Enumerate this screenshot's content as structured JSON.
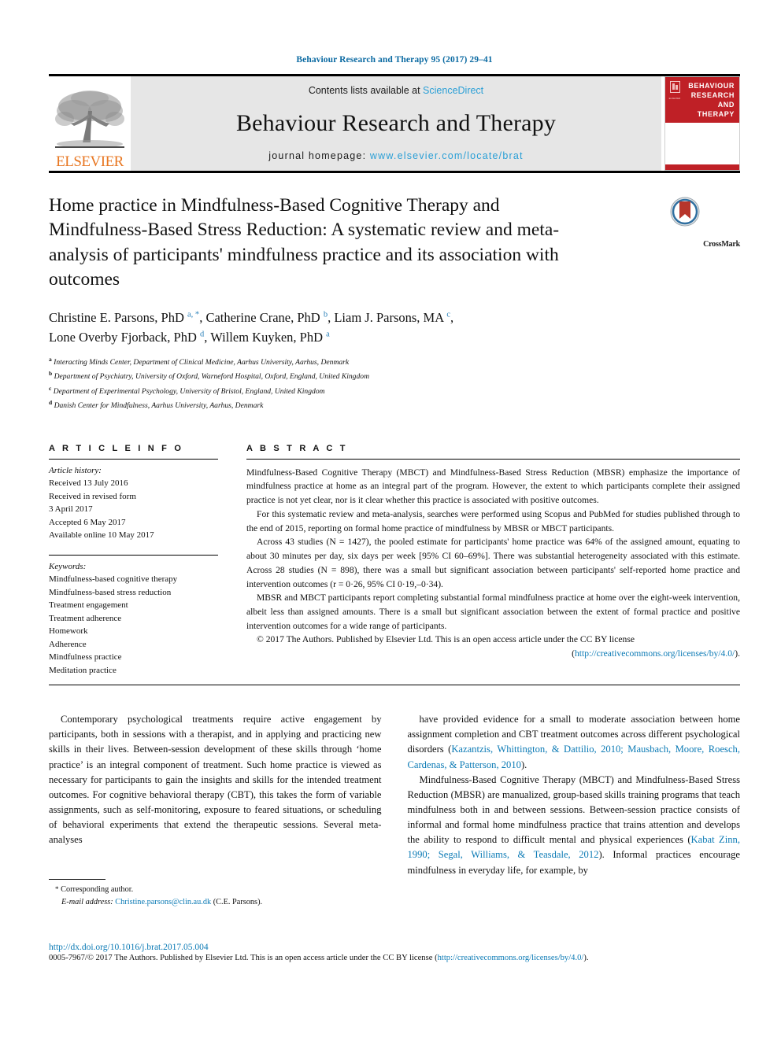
{
  "running_head": "Behaviour Research and Therapy 95 (2017) 29–41",
  "masthead": {
    "publisher_logo_label": "ELSEVIER",
    "contents_prefix": "Contents lists available at ",
    "contents_link": "ScienceDirect",
    "journal_title": "Behaviour Research and Therapy",
    "homepage_prefix": "journal homepage: ",
    "homepage_link": "www.elsevier.com/locate/brat",
    "cover_title_lines": [
      "BEHAVIOUR",
      "RESEARCH AND",
      "THERAPY"
    ],
    "cover_mark_text": "ELSEVIER"
  },
  "crossmark": {
    "label": "CrossMark"
  },
  "article": {
    "title": "Home practice in Mindfulness-Based Cognitive Therapy and Mindfulness-Based Stress Reduction: A systematic review and meta-analysis of participants' mindfulness practice and its association with outcomes",
    "authors_line_1_parts": [
      {
        "text": "Christine E. Parsons, PhD "
      },
      {
        "sup": "a, *"
      },
      {
        "text": ", Catherine Crane, PhD "
      },
      {
        "sup": "b"
      },
      {
        "text": ", Liam J. Parsons, MA "
      },
      {
        "sup": "c"
      },
      {
        "text": ","
      }
    ],
    "authors_line_2_parts": [
      {
        "text": "Lone Overby Fjorback, PhD "
      },
      {
        "sup": "d"
      },
      {
        "text": ", Willem Kuyken, PhD "
      },
      {
        "sup": "a"
      }
    ],
    "affiliations": [
      {
        "marker": "a",
        "text": "Interacting Minds Center, Department of Clinical Medicine, Aarhus University, Aarhus, Denmark"
      },
      {
        "marker": "b",
        "text": "Department of Psychiatry, University of Oxford, Warneford Hospital, Oxford, England, United Kingdom"
      },
      {
        "marker": "c",
        "text": "Department of Experimental Psychology, University of Bristol, England, United Kingdom"
      },
      {
        "marker": "d",
        "text": "Danish Center for Mindfulness, Aarhus University, Aarhus, Denmark"
      }
    ]
  },
  "article_info": {
    "heading": "A R T I C L E   I N F O",
    "history_label": "Article history:",
    "history": [
      "Received 13 July 2016",
      "Received in revised form",
      "3 April 2017",
      "Accepted 6 May 2017",
      "Available online 10 May 2017"
    ],
    "keywords_label": "Keywords:",
    "keywords": [
      "Mindfulness-based cognitive therapy",
      "Mindfulness-based stress reduction",
      "Treatment engagement",
      "Treatment adherence",
      "Homework",
      "Adherence",
      "Mindfulness practice",
      "Meditation practice"
    ]
  },
  "abstract": {
    "heading": "A B S T R A C T",
    "paragraphs": [
      "Mindfulness-Based Cognitive Therapy (MBCT) and Mindfulness-Based Stress Reduction (MBSR) emphasize the importance of mindfulness practice at home as an integral part of the program. However, the extent to which participants complete their assigned practice is not yet clear, nor is it clear whether this practice is associated with positive outcomes.",
      "For this systematic review and meta-analysis, searches were performed using Scopus and PubMed for studies published through to the end of 2015, reporting on formal home practice of mindfulness by MBSR or MBCT participants.",
      "Across 43 studies (N = 1427), the pooled estimate for participants' home practice was 64% of the assigned amount, equating to about 30 minutes per day, six days per week [95% CI 60–69%]. There was substantial heterogeneity associated with this estimate. Across 28 studies (N = 898), there was a small but significant association between participants' self-reported home practice and intervention outcomes (r = 0·26, 95% CI 0·19,–0·34).",
      "MBSR and MBCT participants report completing substantial formal mindfulness practice at home over the eight-week intervention, albeit less than assigned amounts. There is a small but significant association between the extent of formal practice and positive intervention outcomes for a wide range of participants."
    ],
    "copyright_text": "© 2017 The Authors. Published by Elsevier Ltd. This is an open access article under the CC BY license",
    "license_open_paren": "(",
    "license_link": "http://creativecommons.org/licenses/by/4.0/",
    "license_close_paren": ")."
  },
  "body": {
    "left_paragraph": "Contemporary psychological treatments require active engagement by participants, both in sessions with a therapist, and in applying and practicing new skills in their lives. Between-session development of these skills through ‘home practice’ is an integral component of treatment. Such home practice is viewed as necessary for participants to gain the insights and skills for the intended treatment outcomes. For cognitive behavioral therapy (CBT), this takes the form of variable assignments, such as self-monitoring, exposure to feared situations, or scheduling of behavioral experiments that extend the therapeutic sessions. Several meta-analyses",
    "right_paragraph_1_pre": "have provided evidence for a small to moderate association between home assignment completion and CBT treatment outcomes across different psychological disorders (",
    "right_paragraph_1_cite": "Kazantzis, Whittington, & Dattilio, 2010; Mausbach, Moore, Roesch, Cardenas, & Patterson, 2010",
    "right_paragraph_1_post": ").",
    "right_paragraph_2_pre": "Mindfulness-Based Cognitive Therapy (MBCT) and Mindfulness-Based Stress Reduction (MBSR) are manualized, group-based skills training programs that teach mindfulness both in and between sessions. Between-session practice consists of informal and formal home mindfulness practice that trains attention and develops the ability to respond to difficult mental and physical experiences (",
    "right_paragraph_2_cite": "Kabat Zinn, 1990; Segal, Williams, & Teasdale, 2012",
    "right_paragraph_2_post": "). Informal practices encourage mindfulness in everyday life, for example, by"
  },
  "footnote": {
    "star": "*",
    "corresponding": "Corresponding author.",
    "email_label": "E-mail address:",
    "email": "Christine.parsons@clin.au.dk",
    "email_owner": "(C.E. Parsons)."
  },
  "page_footer": {
    "doi": "http://dx.doi.org/10.1016/j.brat.2017.05.004",
    "issn_prefix": "0005-7967/© 2017 The Authors. Published by Elsevier Ltd. This is an open access article under the CC BY license (",
    "issn_link": "http://creativecommons.org/licenses/by/4.0/",
    "issn_suffix": ")."
  },
  "colors": {
    "link_blue": "#0b7ab5",
    "sciencedirect_blue": "#2a9fd6",
    "elsevier_orange": "#e87722",
    "cover_red": "#bf2026",
    "superscript_blue": "#2a80b9"
  }
}
